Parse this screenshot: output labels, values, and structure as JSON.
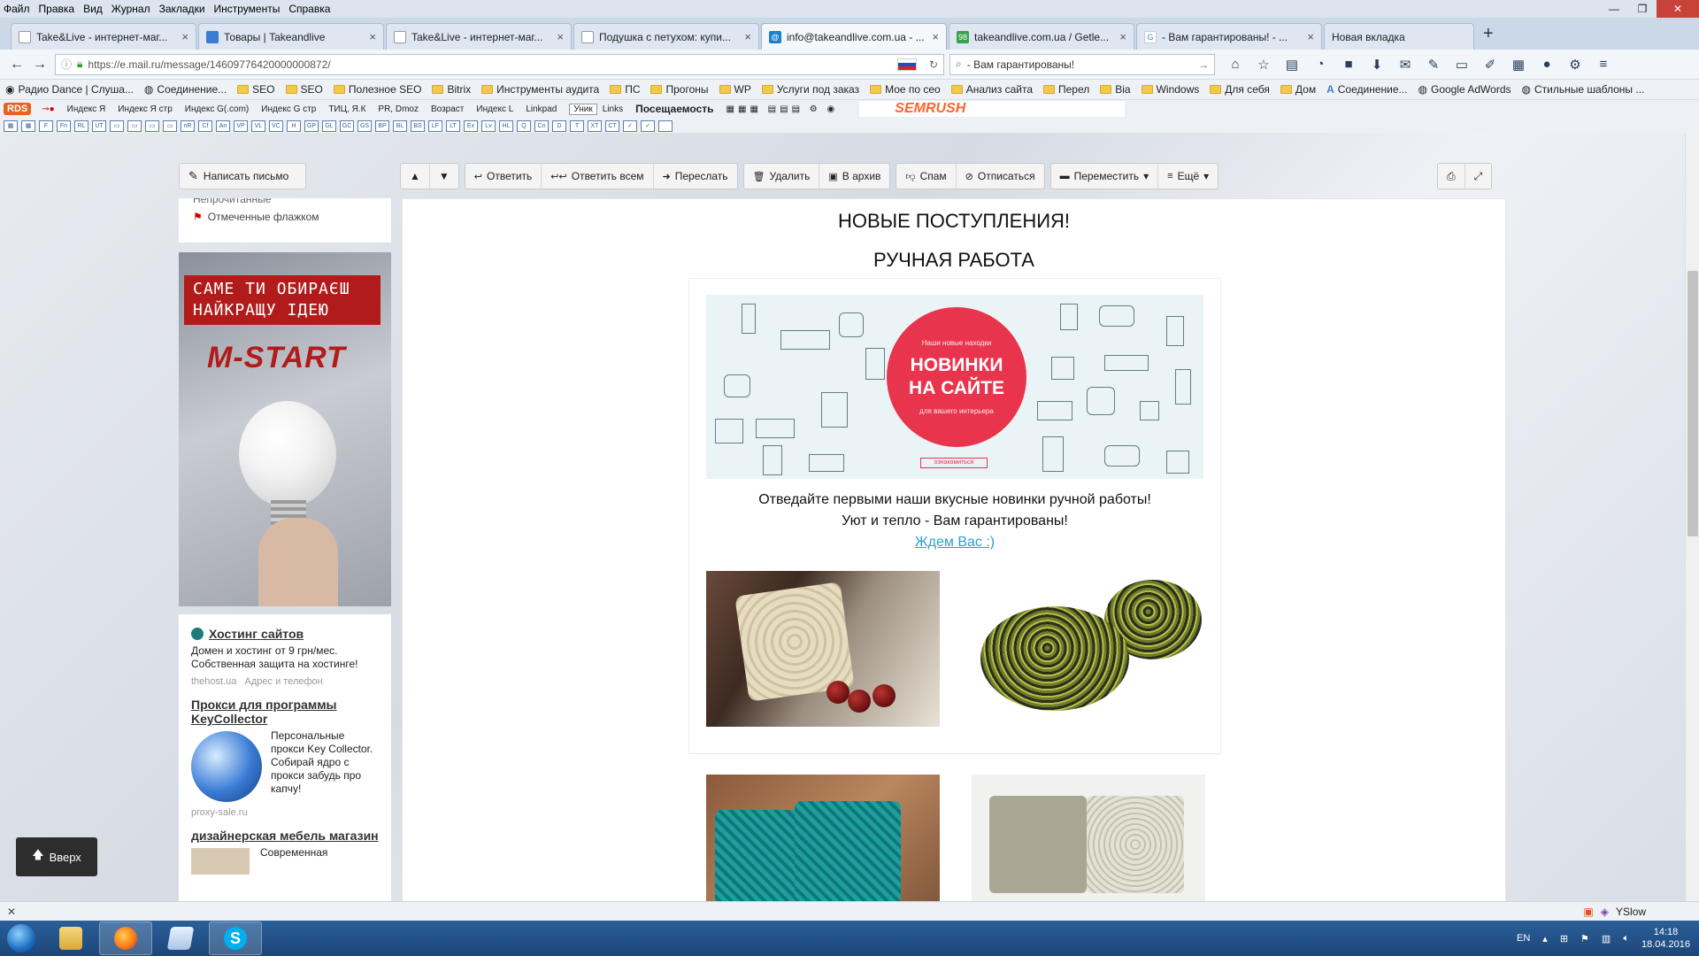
{
  "menu": [
    "Файл",
    "Правка",
    "Вид",
    "Журнал",
    "Закладки",
    "Инструменты",
    "Справка"
  ],
  "tabs": [
    {
      "title": "Take&Live - интернет-маг...",
      "active": false
    },
    {
      "title": "Товары | Takeandlive",
      "active": false
    },
    {
      "title": "Take&Live - интернет-маг...",
      "active": false
    },
    {
      "title": "Подушка с петухом: купи...",
      "active": false
    },
    {
      "title": "info@takeandlive.com.ua - ...",
      "active": true
    },
    {
      "title": "takeandlive.com.ua / Getle...",
      "active": false
    },
    {
      "title": "- Вам гарантированы! - ...",
      "active": false
    },
    {
      "title": "Новая вкладка",
      "active": false
    }
  ],
  "nav": {
    "url": "https://e.mail.ru/message/14609776420000000872/",
    "search": "- Вам гарантированы!"
  },
  "bookmarks": [
    "Радио Dance | Слуша...",
    "Соединение...",
    "SEO",
    "SEO",
    "Полезное SEO",
    "Bitrix",
    "Инструменты аудита",
    "ПС",
    "Прогоны",
    "WP",
    "Услуги под заказ",
    "Мое по сео",
    "Анализ сайта",
    "Перел",
    "Bia",
    "Windows",
    "Для себя",
    "Дом",
    "Соединение...",
    "Google AdWords",
    "Стильные шаблоны ..."
  ],
  "seobar": {
    "rds": "RDS",
    "items": [
      "Индекс Я",
      "Индекс Я стр",
      "Индекс G(.com)",
      "Индекс G стр",
      "ТИЦ, Я.К",
      "PR, Dmoz",
      "Возраст",
      "Индекс L",
      "Linkpad"
    ],
    "unik": "Уник",
    "links": "Links",
    "attendance": "Посещаемость",
    "semrush": "SEMRUSH"
  },
  "mail": {
    "compose": "Написать письмо",
    "buttons": {
      "reply": "Ответить",
      "reply_all": "Ответить всем",
      "forward": "Переслать",
      "delete": "Удалить",
      "archive": "В архив",
      "spam": "Спам",
      "unsubscribe": "Отписаться",
      "move": "Переместить",
      "more": "Ещё"
    },
    "folders": {
      "unread": "Непрочитанные",
      "flagged": "Отмеченные флажком"
    }
  },
  "banner": {
    "line1": "САМЕ ТИ ОБИРАЄШ",
    "line2": "НАЙКРАЩУ ІДЕЮ",
    "brand": "M-START"
  },
  "ads": [
    {
      "title": "Хостинг сайтов",
      "desc": "Домен и хостинг от 9 грн/мес. Собственная защита на хостинге!",
      "meta1": "thehost.ua",
      "meta2": "Адрес и телефон"
    },
    {
      "title": "Прокси для программы KeyCollector",
      "desc": "Персональные прокси Key Collector. Собирай ядро с прокси забудь про капчу!",
      "meta1": "proxy-sale.ru"
    },
    {
      "title": "дизайнерская мебель магазин",
      "desc": "Современная"
    }
  ],
  "to_top": "Вверх",
  "email": {
    "heading1": "НОВЫЕ ПОСТУПЛЕНИЯ!",
    "heading2": "РУЧНАЯ РАБОТА",
    "hero_small": "Наши новые находки",
    "hero_big1": "НОВИНКИ",
    "hero_big2": "НА САЙТЕ",
    "hero_sub": "для вашего интерьера",
    "hero_cta": "ознакомиться",
    "line1": "Отведайте первыми наши вкусные новинки ручной работы!",
    "line2": "Уют и тепло - Вам гарантированы!",
    "link": "Ждем Вас :)"
  },
  "status": {
    "yslow": "YSlow"
  },
  "tray": {
    "lang": "EN",
    "time": "14:18",
    "date": "18.04.2016"
  }
}
